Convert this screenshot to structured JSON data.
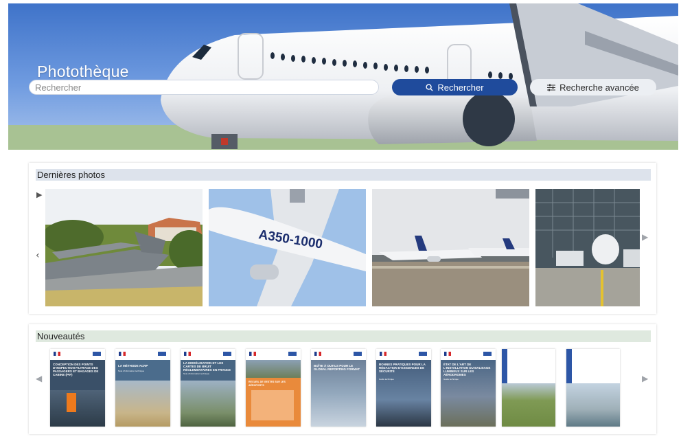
{
  "hero": {
    "title": "Photothèque",
    "search_placeholder": "Rechercher",
    "search_button_label": "Rechercher",
    "advanced_button_label": "Recherche avancée"
  },
  "sections": {
    "latest_photos": {
      "title": "Dernières photos",
      "photos": [
        {
          "alt": "military-transport-aircraft"
        },
        {
          "alt": "a350-1000-underside",
          "text": "A350-1000"
        },
        {
          "alt": "air-france-aircraft-on-tarmac"
        },
        {
          "alt": "aircraft-in-hangar"
        }
      ]
    },
    "news": {
      "title": "Nouveautés",
      "documents": [
        {
          "title": "Conception des points d'inspection filtrage des passagers et bagages de cabine (PIF)",
          "subtitle": ""
        },
        {
          "title": "La méthode ACRP",
          "subtitle": "Note d'information technique"
        },
        {
          "title": "La modélisation et les cartes de bruit réglementaires en France",
          "subtitle": "Note d'information technique"
        },
        {
          "title": "Recueil de gestes sur les aéroports",
          "subtitle": ""
        },
        {
          "title": "Boîte à outils pour le global reporting format",
          "subtitle": ""
        },
        {
          "title": "Bonnes pratiques pour la rédaction d'exigences de sécurité",
          "subtitle": "Guide technique"
        },
        {
          "title": "État de l'art de l'installation du balisage lumineux sur les aérodromes",
          "subtitle": "Guide technique"
        },
        {
          "title": "",
          "subtitle": ""
        },
        {
          "title": "",
          "subtitle": ""
        }
      ]
    }
  },
  "colors": {
    "primary_button": "#1f4b9c",
    "secondary_button": "#eceff3",
    "photos_header_bg": "#dde3ec",
    "news_header_bg": "#dfe9df"
  },
  "icons": {
    "search": "search-icon",
    "advanced": "sliders-icon",
    "play": "play-icon",
    "prev": "chevron-left-icon",
    "next": "chevron-right-icon"
  }
}
